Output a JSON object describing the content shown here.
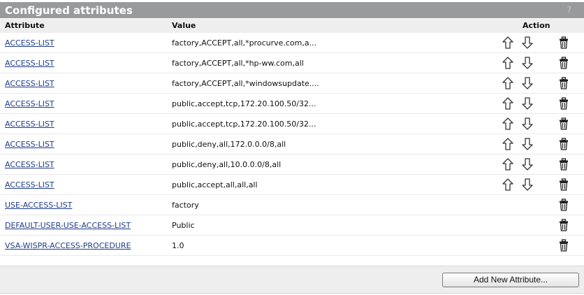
{
  "panel": {
    "title": "Configured attributes",
    "help": "?"
  },
  "columns": {
    "attribute": "Attribute",
    "value": "Value",
    "action": "Action"
  },
  "rows": [
    {
      "attribute": "ACCESS-LIST",
      "value": "factory,ACCEPT,all,*procurve.com,a...",
      "movable": true
    },
    {
      "attribute": "ACCESS-LIST",
      "value": "factory,ACCEPT,all,*hp-ww.com,all",
      "movable": true
    },
    {
      "attribute": "ACCESS-LIST",
      "value": "factory,ACCEPT,all,*windowsupdate....",
      "movable": true
    },
    {
      "attribute": "ACCESS-LIST",
      "value": "public,accept,tcp,172.20.100.50/32...",
      "movable": true
    },
    {
      "attribute": "ACCESS-LIST",
      "value": "public,accept,tcp,172.20.100.50/32...",
      "movable": true
    },
    {
      "attribute": "ACCESS-LIST",
      "value": "public,deny,all,172.0.0.0/8,all",
      "movable": true
    },
    {
      "attribute": "ACCESS-LIST",
      "value": "public,deny,all,10.0.0.0/8,all",
      "movable": true
    },
    {
      "attribute": "ACCESS-LIST",
      "value": "public,accept,all,all,all",
      "movable": true
    },
    {
      "attribute": "USE-ACCESS-LIST",
      "value": "factory",
      "movable": false
    },
    {
      "attribute": "DEFAULT-USER-USE-ACCESS-LIST",
      "value": "Public",
      "movable": false
    },
    {
      "attribute": "VSA-WISPR-ACCESS-PROCEDURE",
      "value": "1.0",
      "movable": false
    }
  ],
  "footer": {
    "add_button": "Add New Attribute..."
  },
  "icons": {
    "up": "arrow-up-icon",
    "down": "arrow-down-icon",
    "delete": "trash-icon"
  },
  "colors": {
    "titlebar": "#999a9c",
    "header": "#eeeeee",
    "link": "#1f3c88"
  }
}
